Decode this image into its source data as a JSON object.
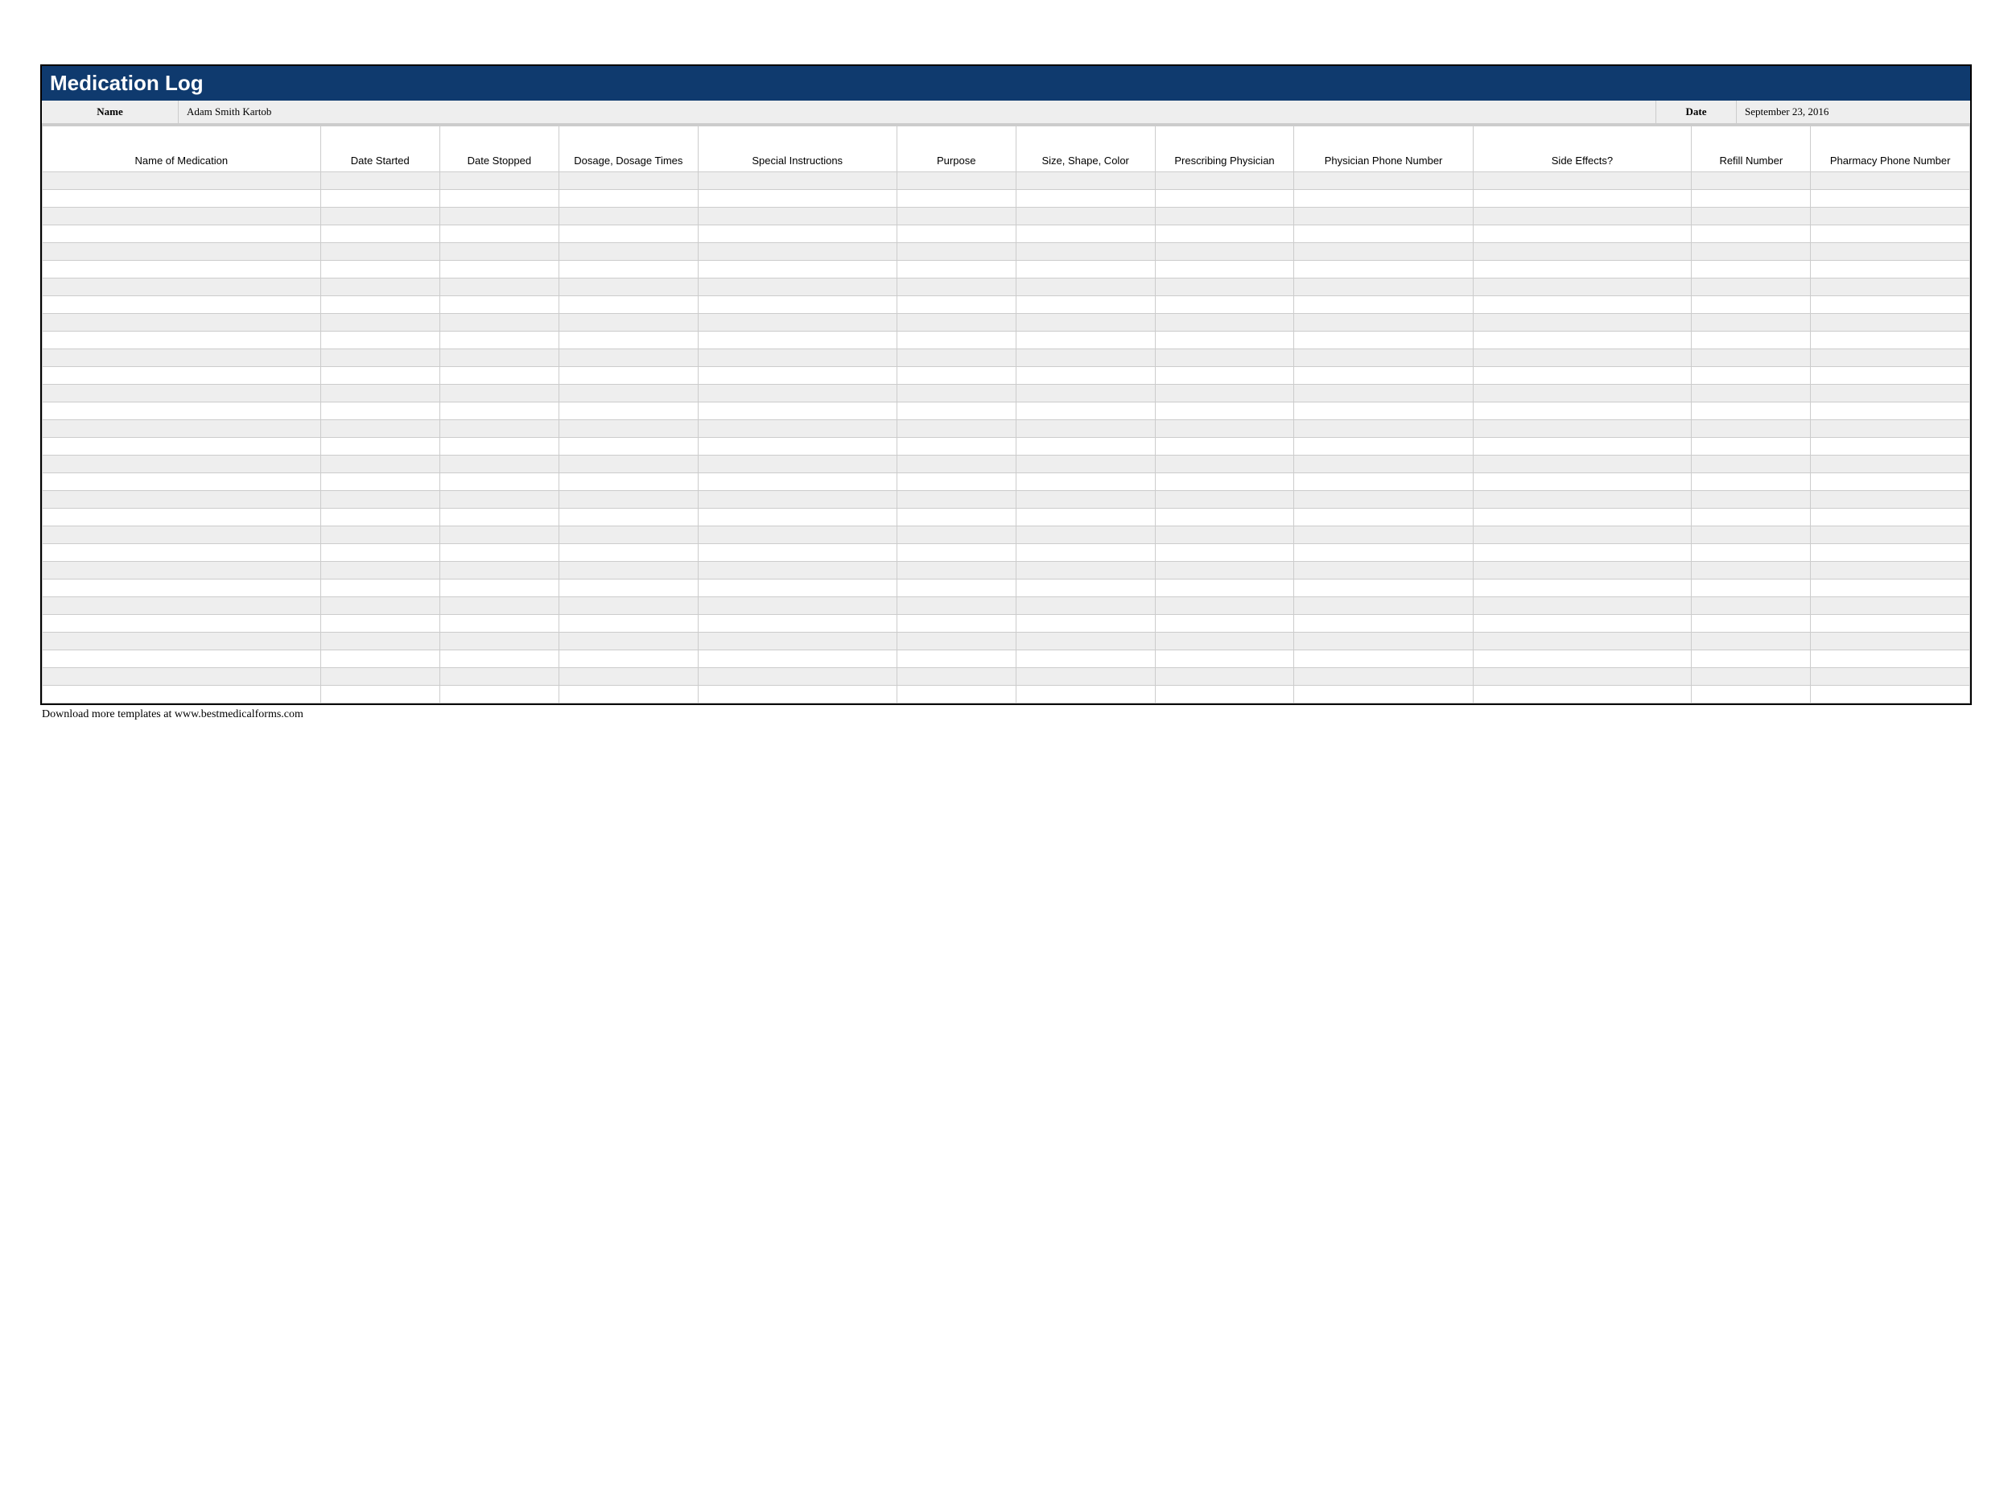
{
  "title": "Medication Log",
  "info": {
    "name_label": "Name",
    "name_value": "Adam Smith Kartob",
    "date_label": "Date",
    "date_value": "September 23, 2016"
  },
  "columns": [
    "Name of Medication",
    "Date Started",
    "Date Stopped",
    "Dosage, Dosage Times",
    "Special Instructions",
    "Purpose",
    "Size, Shape, Color",
    "Prescribing Physician",
    "Physician Phone Number",
    "Side Effects?",
    "Refill Number",
    "Pharmacy Phone Number"
  ],
  "row_count": 30,
  "footer": "Download more templates at www.bestmedicalforms.com"
}
